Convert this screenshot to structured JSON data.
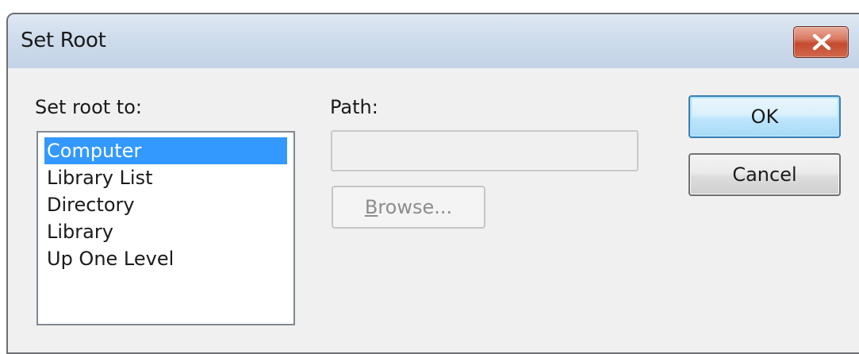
{
  "window": {
    "title": "Set Root",
    "close_icon": "close-x-icon"
  },
  "root_list": {
    "label": "Set root to:",
    "items": [
      "Computer",
      "Library List",
      "Directory",
      "Library",
      "Up One Level"
    ],
    "selected": "Computer"
  },
  "path": {
    "label": "Path:",
    "value": ""
  },
  "browse": {
    "mnemonic": "B",
    "rest": "rowse..."
  },
  "buttons": {
    "ok": "OK",
    "cancel": "Cancel"
  },
  "colors": {
    "selection": "#3399ff",
    "titlebar": "#cedcec",
    "close": "#c44a2e"
  }
}
